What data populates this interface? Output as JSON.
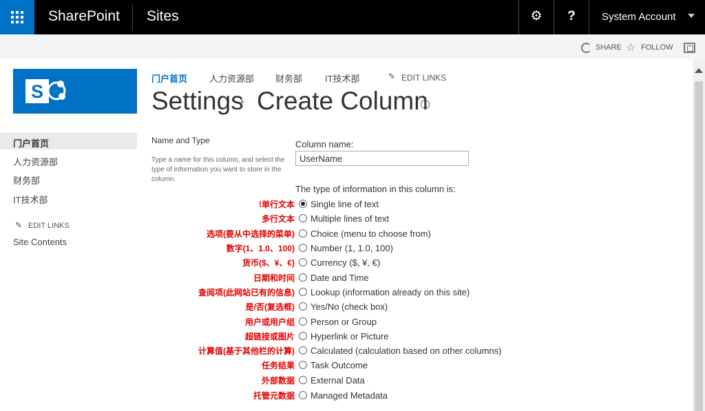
{
  "topbar": {
    "brand": "SharePoint",
    "sites": "Sites",
    "account": "System Account",
    "help": "?"
  },
  "suitebar": {
    "share": "SHARE",
    "follow": "FOLLOW"
  },
  "leftnav": {
    "items": [
      "门户首页",
      "人力资源部",
      "财务部",
      "IT技术部"
    ],
    "edit_links": "EDIT LINKS",
    "site_contents": "Site Contents"
  },
  "topnav": {
    "items": [
      "门户首页",
      "人力资源部",
      "财务部",
      "IT技术部"
    ],
    "edit_links": "EDIT LINKS"
  },
  "page": {
    "breadcrumb_root": "Settings",
    "title": "Create Column",
    "info": "i"
  },
  "section": {
    "title": "Name and Type",
    "description": "Type a name for this column, and select the type of information you want to store in the column."
  },
  "form": {
    "column_name_label": "Column name:",
    "column_name_value": "UserName",
    "type_label": "The type of information in this column is:",
    "options": [
      {
        "annotation": "!单行文本",
        "label": "Single line of text",
        "checked": true
      },
      {
        "annotation": "多行文本",
        "label": "Multiple lines of text",
        "checked": false
      },
      {
        "annotation": "选项(要从中选择的菜单)",
        "label": "Choice (menu to choose from)",
        "checked": false
      },
      {
        "annotation": "数字(1、1.0、100)",
        "label": "Number (1, 1.0, 100)",
        "checked": false
      },
      {
        "annotation": "货币($、¥、€)",
        "label": "Currency ($, ¥, €)",
        "checked": false
      },
      {
        "annotation": "日期和时间",
        "label": "Date and Time",
        "checked": false
      },
      {
        "annotation": "查阅项(此网站已有的信息)",
        "label": "Lookup (information already on this site)",
        "checked": false
      },
      {
        "annotation": "是/否(复选框)",
        "label": "Yes/No (check box)",
        "checked": false
      },
      {
        "annotation": "用户或用户组",
        "label": "Person or Group",
        "checked": false
      },
      {
        "annotation": "超链接或图片",
        "label": "Hyperlink or Picture",
        "checked": false
      },
      {
        "annotation": "计算值(基于其他栏的计算)",
        "label": "Calculated (calculation based on other columns)",
        "checked": false
      },
      {
        "annotation": "任务结果",
        "label": "Task Outcome",
        "checked": false
      },
      {
        "annotation": "外部数据",
        "label": "External Data",
        "checked": false
      },
      {
        "annotation": "托管元数据",
        "label": "Managed Metadata",
        "checked": false
      }
    ]
  },
  "colors": {
    "brand_blue": "#0072c6",
    "annotation_red": "#e00000"
  }
}
